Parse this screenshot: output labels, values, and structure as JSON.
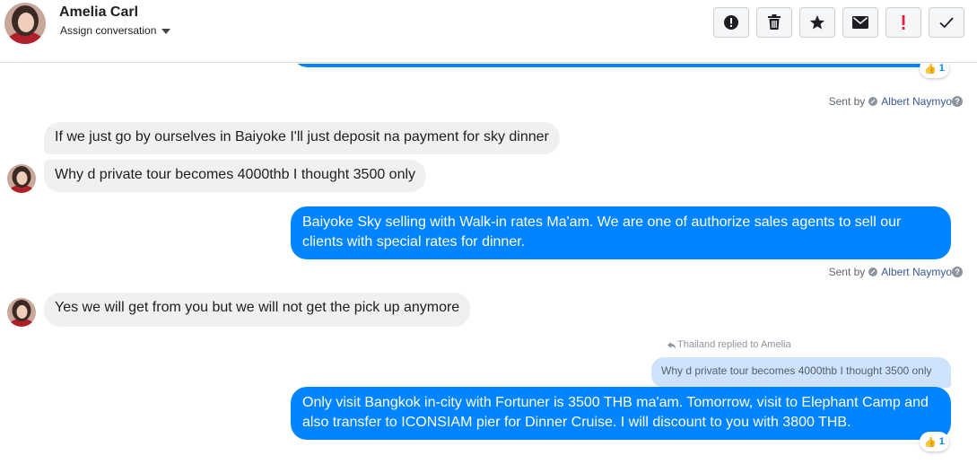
{
  "header": {
    "contact_name": "Amelia Carl",
    "assign_label": "Assign conversation",
    "actions": [
      {
        "name": "alert-circle-icon"
      },
      {
        "name": "trash-icon"
      },
      {
        "name": "star-icon"
      },
      {
        "name": "envelope-icon"
      },
      {
        "name": "exclamation-icon",
        "color": "#e41e3f"
      },
      {
        "name": "checkmark-icon"
      }
    ]
  },
  "thread": {
    "top_reaction": {
      "emoji": "thumbs-up-icon",
      "count": "1"
    },
    "sent_by_1": {
      "prefix": "Sent by",
      "agent": "Albert Naymyo"
    },
    "incoming_1": "If we just go by ourselves in Baiyoke I'll just deposit na payment for sky dinner",
    "incoming_2": "Why d private tour becomes 4000thb I thought 3500 only",
    "outgoing_1": "Baiyoke Sky selling with Walk-in rates Ma'am. We are one of authorize sales agents to sell our clients with special rates for dinner.",
    "sent_by_2": {
      "prefix": "Sent by",
      "agent": "Albert Naymyo"
    },
    "incoming_3": "Yes we will get from you but we will not get the pick up anymore",
    "reply_note": "Thailand replied to Amelia",
    "quoted": "Why d private tour becomes 4000thb I thought 3500 only",
    "outgoing_2": "Only visit Bangkok in-city with Fortuner is 3500 THB ma'am. Tomorrow, visit to Elephant Camp and also transfer to ICONSIAM pier for Dinner Cruise. I will discount to you with 3800 THB.",
    "bottom_reaction": {
      "emoji": "thumbs-up-icon",
      "count": "1"
    }
  },
  "colors": {
    "accent": "#0084ff",
    "incoming_bg": "#f0f0f0",
    "quote_bg": "#cfe2fc",
    "link": "#385898"
  }
}
